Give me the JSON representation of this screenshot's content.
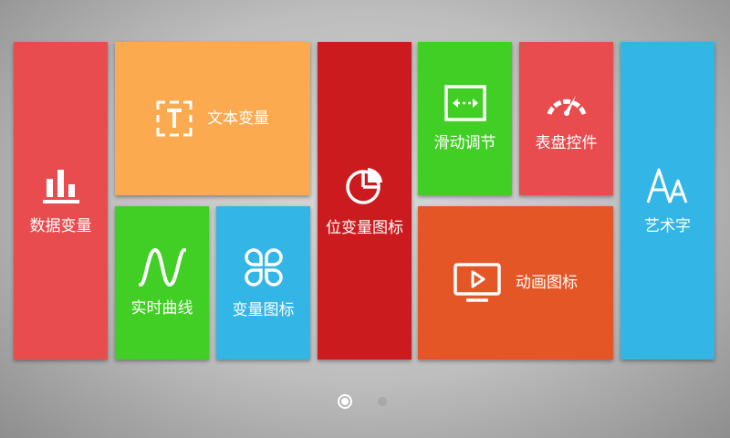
{
  "tiles": [
    {
      "id": "data-variable",
      "label": "数据变量",
      "icon": "bar-chart-icon",
      "color": "#e84c4f"
    },
    {
      "id": "text-variable",
      "label": "文本变量",
      "icon": "text-frame-icon",
      "color": "#fcaa4f"
    },
    {
      "id": "bit-variable-icon",
      "label": "位变量图标",
      "icon": "pie-chart-icon",
      "color": "#cc1b1e"
    },
    {
      "id": "slider",
      "label": "滑动调节",
      "icon": "slider-arrows-icon",
      "color": "#42cf25"
    },
    {
      "id": "gauge-control",
      "label": "表盘控件",
      "icon": "gauge-icon",
      "color": "#e84c4f"
    },
    {
      "id": "art-text",
      "label": "艺术字",
      "icon": "letters-icon",
      "color": "#33b5e5"
    },
    {
      "id": "realtime-curve",
      "label": "实时曲线",
      "icon": "sine-wave-icon",
      "color": "#42cf25"
    },
    {
      "id": "variable-icon",
      "label": "变量图标",
      "icon": "clover-icon",
      "color": "#33b5e5"
    },
    {
      "id": "animation-icon",
      "label": "动画图标",
      "icon": "video-play-icon",
      "color": "#e55626"
    }
  ],
  "pagination": {
    "total": 2,
    "current": 1
  }
}
